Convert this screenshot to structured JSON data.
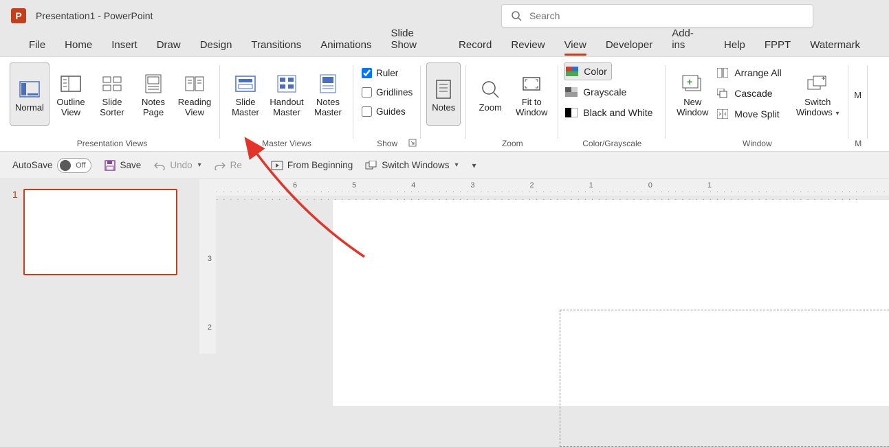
{
  "app": {
    "icon_letter": "P",
    "title": "Presentation1  -  PowerPoint"
  },
  "search": {
    "placeholder": "Search"
  },
  "tabs": [
    {
      "label": "File"
    },
    {
      "label": "Home"
    },
    {
      "label": "Insert"
    },
    {
      "label": "Draw"
    },
    {
      "label": "Design"
    },
    {
      "label": "Transitions"
    },
    {
      "label": "Animations"
    },
    {
      "label": "Slide Show"
    },
    {
      "label": "Record"
    },
    {
      "label": "Review"
    },
    {
      "label": "View",
      "active": true
    },
    {
      "label": "Developer"
    },
    {
      "label": "Add-ins"
    },
    {
      "label": "Help"
    },
    {
      "label": "FPPT"
    },
    {
      "label": "Watermark"
    }
  ],
  "ribbon": {
    "presentation_views": {
      "label": "Presentation Views",
      "normal": "Normal",
      "outline_l1": "Outline",
      "outline_l2": "View",
      "sorter_l1": "Slide",
      "sorter_l2": "Sorter",
      "notespage_l1": "Notes",
      "notespage_l2": "Page",
      "reading_l1": "Reading",
      "reading_l2": "View"
    },
    "master_views": {
      "label": "Master Views",
      "slide_l1": "Slide",
      "slide_l2": "Master",
      "handout_l1": "Handout",
      "handout_l2": "Master",
      "notes_l1": "Notes",
      "notes_l2": "Master"
    },
    "show": {
      "label": "Show",
      "ruler": "Ruler",
      "gridlines": "Gridlines",
      "guides": "Guides",
      "ruler_checked": true,
      "gridlines_checked": false,
      "guides_checked": false
    },
    "notes_btn": "Notes",
    "zoom": {
      "label": "Zoom",
      "zoom": "Zoom",
      "fit_l1": "Fit to",
      "fit_l2": "Window"
    },
    "color": {
      "label": "Color/Grayscale",
      "color": "Color",
      "grayscale": "Grayscale",
      "bw": "Black and White"
    },
    "window": {
      "label": "Window",
      "new_l1": "New",
      "new_l2": "Window",
      "arrange": "Arrange All",
      "cascade": "Cascade",
      "movesplit": "Move Split",
      "switch_l1": "Switch",
      "switch_l2": "Windows"
    }
  },
  "qat": {
    "autosave": "AutoSave",
    "autosave_off": "Off",
    "save": "Save",
    "undo": "Undo",
    "redo": "Re",
    "from_beginning": "From Beginning",
    "switch_windows": "Switch Windows"
  },
  "slide": {
    "number": "1"
  },
  "ruler": {
    "h_labels": [
      "6",
      "5",
      "4",
      "3",
      "2",
      "1",
      "0",
      "1"
    ],
    "v_labels": [
      "3",
      "2"
    ]
  }
}
